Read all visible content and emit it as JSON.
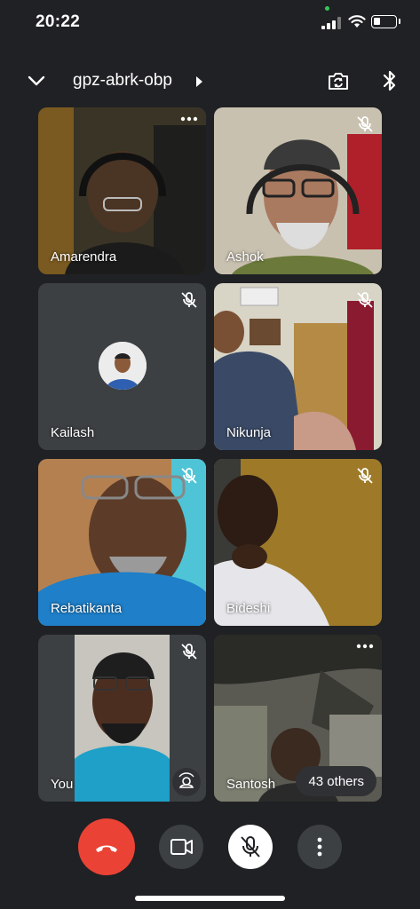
{
  "status": {
    "time": "20:22"
  },
  "header": {
    "meeting_code": "gpz-abrk-obp",
    "icons": [
      "chevron-down-icon",
      "camera-flip-icon",
      "bluetooth-icon"
    ]
  },
  "participants": [
    {
      "name": "Amarendra",
      "muted": false,
      "more": true
    },
    {
      "name": "Ashok",
      "muted": true
    },
    {
      "name": "Kailash",
      "muted": true,
      "avatar": true
    },
    {
      "name": "Nikunja",
      "muted": true
    },
    {
      "name": "Rebatikanta",
      "muted": true
    },
    {
      "name": "Bideshi",
      "muted": true
    },
    {
      "name": "You",
      "muted": true
    },
    {
      "name": "Santosh",
      "muted": false,
      "more": true
    }
  ],
  "others": {
    "label": "43 others"
  },
  "controls": {
    "end_call_color": "#ea4335",
    "icons": [
      "end-call-icon",
      "camera-icon",
      "mic-off-icon",
      "more-vert-icon"
    ]
  },
  "colors": {
    "background": "#202124",
    "tile": "#3c4043",
    "accent_red": "#ea4335"
  }
}
